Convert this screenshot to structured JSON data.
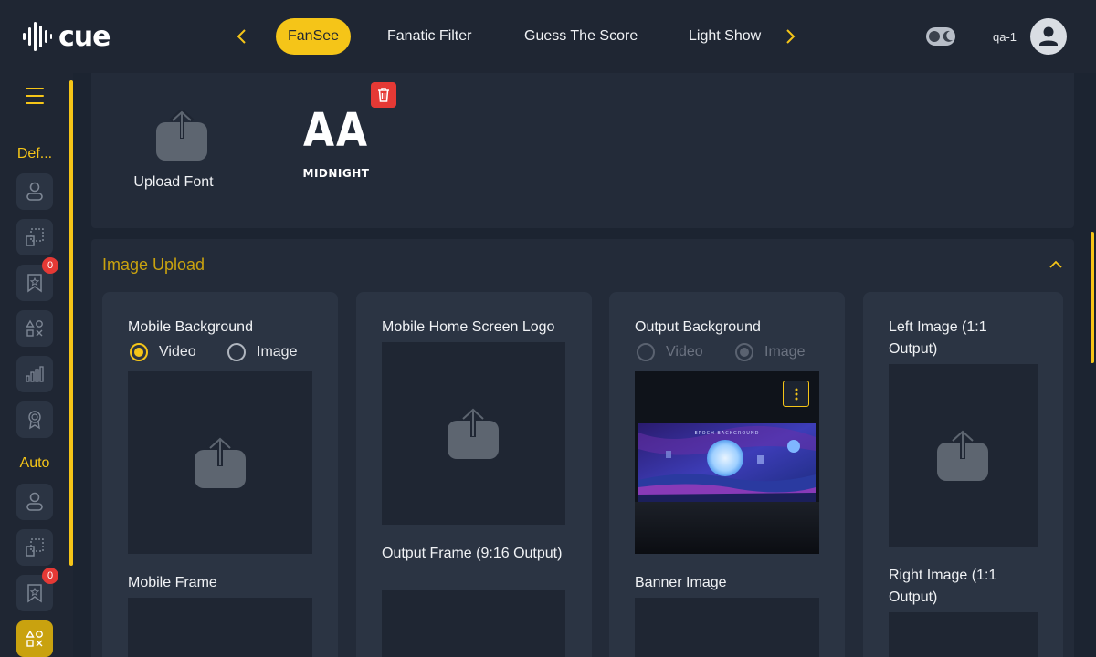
{
  "brand": {
    "name": "cue"
  },
  "nav": {
    "tabs": [
      {
        "label": "FanSee",
        "active": true
      },
      {
        "label": "Fanatic Filter"
      },
      {
        "label": "Guess The Score"
      },
      {
        "label": "Light Show"
      }
    ]
  },
  "user": {
    "name": "qa-1"
  },
  "sidebar": {
    "group1_label": "Def...",
    "group2_label": "Auto",
    "badge_count_1": "0",
    "badge_count_2": "0"
  },
  "fonts": {
    "upload_label": "Upload Font",
    "items": [
      {
        "glyph": "AA",
        "name": "MIDNIGHT"
      }
    ]
  },
  "image_upload": {
    "title": "Image Upload",
    "cards": [
      {
        "title": "Mobile Background",
        "radio": [
          "Video",
          "Image"
        ],
        "selected": "Video",
        "second_title": "Mobile Frame"
      },
      {
        "title": "Mobile Home Screen Logo",
        "second_title": "Output Frame (9:16 Output)"
      },
      {
        "title": "Output Background",
        "radio": [
          "Video",
          "Image"
        ],
        "selected": "Image",
        "disabled": true,
        "second_title": "Banner Image",
        "preview_caption": "EPOCH BACKGROUND"
      },
      {
        "title": "Left Image (1:1 Output)",
        "second_title": "Right Image (1:1 Output)"
      }
    ]
  },
  "colors": {
    "accent": "#f5c518",
    "danger": "#e53935",
    "panel": "#232b39",
    "card": "#2b3443"
  }
}
